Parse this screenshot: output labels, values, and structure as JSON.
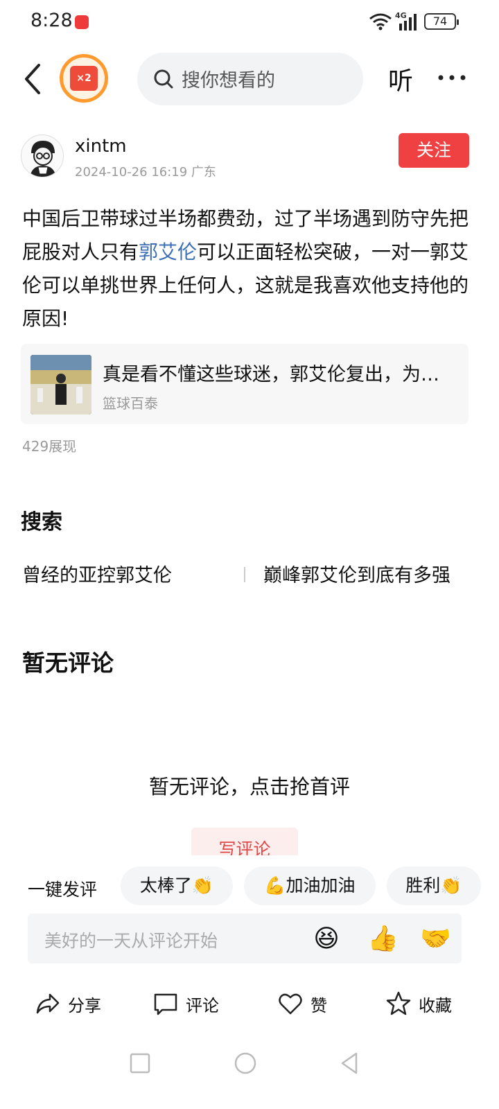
{
  "status": {
    "time": "8:28",
    "network": "4G",
    "battery": "74"
  },
  "nav": {
    "reward_badge": "×2",
    "search_placeholder": "搜你想看的",
    "listen_label": "听"
  },
  "author": {
    "name": "xintm",
    "meta": "2024-10-26 16:19  广东",
    "follow_label": "关注"
  },
  "post": {
    "text_before": "中国后卫带球过半场都费劲，过了半场遇到防守先把屁股对人只有",
    "link_text": "郭艾伦",
    "text_after": "可以正面轻松突破，一对一郭艾伦可以单挑世界上任何人，这就是我喜欢他支持他的原因!",
    "views": "429展现"
  },
  "linked_article": {
    "title": "真是看不懂这些球迷，郭艾伦复出，为何还有那么多人喷他？",
    "source": "篮球百泰"
  },
  "search_section": {
    "heading": "搜索",
    "items": [
      "曾经的亚控郭艾伦",
      "巅峰郭艾伦到底有多强"
    ]
  },
  "comments": {
    "heading": "暂无评论",
    "empty_text": "暂无评论，点击抢首评",
    "write_label": "写评论"
  },
  "quick_comment": {
    "label": "一键发评",
    "chips": [
      "太棒了👏",
      "💪加油加油",
      "胜利👏"
    ],
    "input_placeholder": "美好的一天从评论开始",
    "emojis": [
      "😆",
      "👍",
      "🤝"
    ]
  },
  "actions": {
    "share": "分享",
    "comment": "评论",
    "like": "赞",
    "collect": "收藏"
  }
}
